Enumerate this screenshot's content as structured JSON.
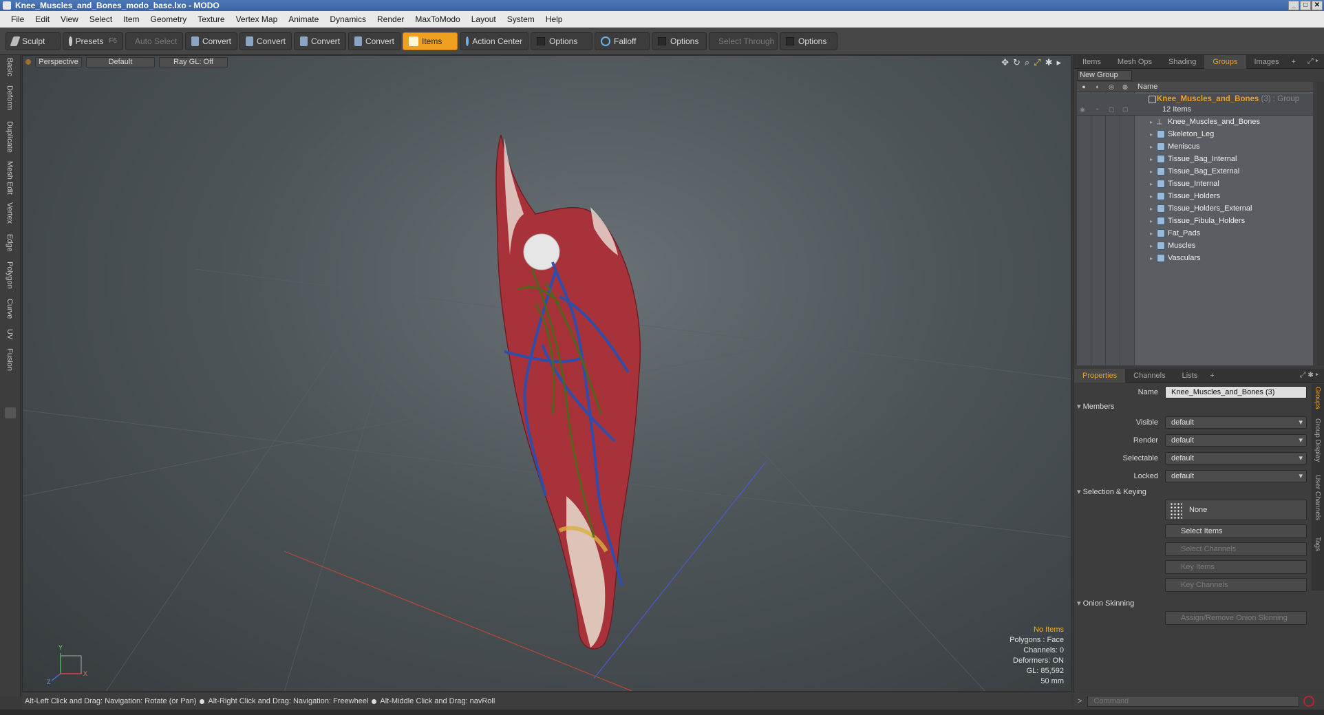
{
  "window": {
    "title": "Knee_Muscles_and_Bones_modo_base.lxo - MODO",
    "controls": [
      "_",
      "□",
      "✕"
    ]
  },
  "menu": [
    "File",
    "Edit",
    "View",
    "Select",
    "Item",
    "Geometry",
    "Texture",
    "Vertex Map",
    "Animate",
    "Dynamics",
    "Render",
    "MaxToModo",
    "Layout",
    "System",
    "Help"
  ],
  "toolbar": {
    "sculpt": "Sculpt",
    "presets": "Presets",
    "presets_key": "F6",
    "auto_select": "Auto Select",
    "convert1": "Convert",
    "convert2": "Convert",
    "convert3": "Convert",
    "convert4": "Convert",
    "items": "Items",
    "action_center": "Action Center",
    "options1": "Options",
    "falloff": "Falloff",
    "options2": "Options",
    "select_through": "Select Through",
    "options3": "Options"
  },
  "left_tabs": [
    "Basic",
    "Deform",
    "Duplicate",
    "Mesh Edit",
    "Vertex",
    "Edge",
    "Polygon",
    "Curve",
    "UV",
    "Fusion"
  ],
  "viewport": {
    "view": "Perspective",
    "shading": "Default",
    "raygl": "Ray GL: Off",
    "info": {
      "items": "No Items",
      "polygons": "Polygons : Face",
      "channels": "Channels: 0",
      "deformers": "Deformers: ON",
      "gl": "GL: 85,592",
      "scale": "50 mm"
    },
    "axis": {
      "y": "Y",
      "z": "Z",
      "x": "X"
    }
  },
  "items_panel": {
    "tabs": [
      "Items",
      "Mesh Ops",
      "Shading",
      "Groups",
      "Images"
    ],
    "active_tab": "Groups",
    "new_group": "New Group",
    "name_header": "Name",
    "group": {
      "name": "Knee_Muscles_and_Bones",
      "count": "(3)",
      "type": ": Group",
      "sub": "12 Items"
    },
    "rows": [
      "Knee_Muscles_and_Bones",
      "Skeleton_Leg",
      "Meniscus",
      "Tissue_Bag_Internal",
      "Tissue_Bag_External",
      "Tissue_Internal",
      "Tissue_Holders",
      "Tissue_Holders_External",
      "Tissue_Fibula_Holders",
      "Fat_Pads",
      "Muscles",
      "Vasculars"
    ]
  },
  "properties_panel": {
    "tabs": [
      "Properties",
      "Channels",
      "Lists"
    ],
    "active_tab": "Properties",
    "name_label": "Name",
    "name_value": "Knee_Muscles_and_Bones (3)",
    "members": "Members",
    "visible_label": "Visible",
    "visible_value": "default",
    "render_label": "Render",
    "render_value": "default",
    "selectable_label": "Selectable",
    "selectable_value": "default",
    "locked_label": "Locked",
    "locked_value": "default",
    "selection_keying": "Selection & Keying",
    "none": "None",
    "select_items": "Select Items",
    "select_channels": "Select Channels",
    "key_items": "Key Items",
    "key_channels": "Key Channels",
    "onion_skinning": "Onion Skinning",
    "assign_onion": "Assign/Remove Onion Skinning",
    "side_tabs": [
      "Groups",
      "Group Display",
      "User Channels",
      "Tags"
    ]
  },
  "status": {
    "hint1": "Alt-Left Click and Drag: Navigation: Rotate (or Pan)",
    "hint2": "Alt-Right Click and Drag: Navigation: Freewheel",
    "hint3": "Alt-Middle Click and Drag: navRoll"
  },
  "command": {
    "placeholder": "Command"
  },
  "colors": {
    "accent": "#f0a020",
    "muscle": "#a8323a",
    "vein": "#1f3f9a",
    "nerve": "#4a6a1a"
  }
}
